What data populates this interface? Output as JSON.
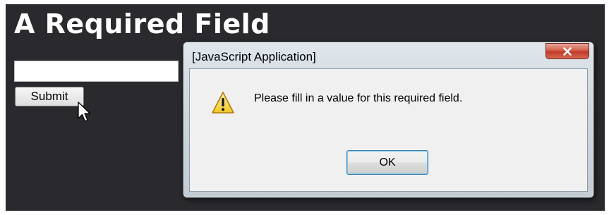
{
  "page": {
    "title": "A Required Field",
    "input_value": "",
    "submit_label": "Submit",
    "background_color": "#2a2a2e"
  },
  "dialog": {
    "title": "[JavaScript Application]",
    "close_icon": "close-x-icon",
    "warning_icon": "warning-triangle-icon",
    "message": "Please fill in a value for this required field.",
    "ok_label": "OK",
    "close_button_color": "#c0392b"
  },
  "cursor": {
    "icon": "arrow-pointer-icon"
  }
}
